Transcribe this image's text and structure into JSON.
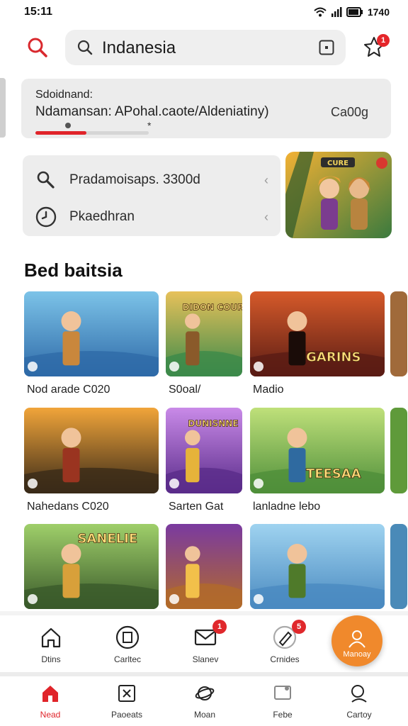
{
  "status_bar": {
    "time": "15:11",
    "battery": "1740"
  },
  "search": {
    "query": "Indanesia"
  },
  "notification_badge": "1",
  "summary": {
    "label": "Sdoidnand:",
    "line": "Ndamansan: APohal.caote/Aldeniatiny)",
    "status": "Ca00g",
    "progress": 0.45,
    "mark": "*"
  },
  "quick_links": [
    {
      "icon": "search-icon",
      "label": "Pradamoisaps. 3300d",
      "chevron": "‹"
    },
    {
      "icon": "clock-icon",
      "label": "Pkaedhran",
      "chevron": "‹"
    }
  ],
  "promo": {
    "text": "CURE"
  },
  "section": {
    "title": "Bed baitsia"
  },
  "tiles": [
    {
      "caption": "Nod arade C020",
      "overlay": ""
    },
    {
      "caption": "S0oal/",
      "overlay": "DIDON COUR"
    },
    {
      "caption": "Madio",
      "overlay": "GARINS"
    },
    {
      "caption": "Nahedans C020",
      "overlay": ""
    },
    {
      "caption": "Sarten Gat",
      "overlay": "DUNISNNE"
    },
    {
      "caption": "lanladne lebo",
      "overlay": "TEESAA"
    },
    {
      "caption": "",
      "overlay": "SANELIE"
    },
    {
      "caption": "",
      "overlay": ""
    },
    {
      "caption": "",
      "overlay": ""
    }
  ],
  "mid_nav": [
    {
      "label": "Dtins",
      "badge": ""
    },
    {
      "label": "Carltec",
      "badge": ""
    },
    {
      "label": "Slanev",
      "badge": "1"
    },
    {
      "label": "Crnides",
      "badge": "5"
    }
  ],
  "fab": {
    "label": "Manoay"
  },
  "tab_bar": [
    {
      "label": "Nead",
      "active": true
    },
    {
      "label": "Paoeats",
      "active": false
    },
    {
      "label": "Moan",
      "active": false
    },
    {
      "label": "Febe",
      "active": false
    },
    {
      "label": "Cartoy",
      "active": false
    }
  ],
  "colors": {
    "accent": "#e0242a",
    "fab": "#f0892c",
    "surface": "#eeeeee"
  }
}
